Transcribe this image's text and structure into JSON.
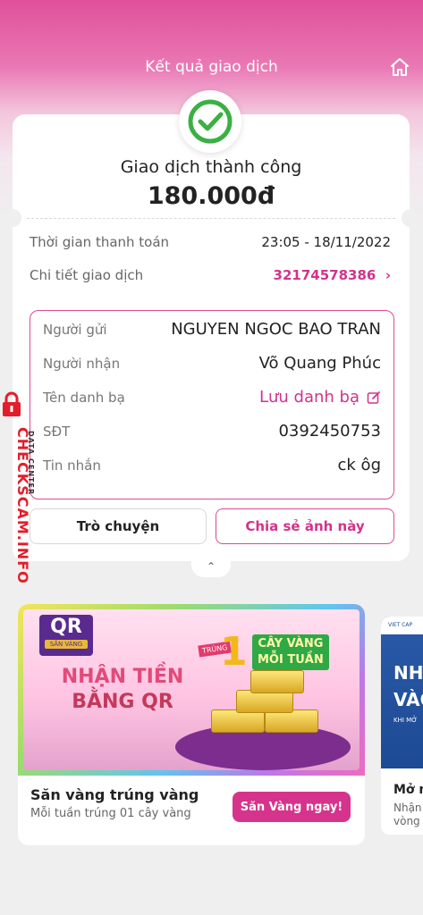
{
  "header": {
    "title": "Kết quả giao dịch",
    "home_icon": "home-icon"
  },
  "status": {
    "text": "Giao dịch thành công",
    "amount": "180.000đ"
  },
  "details": {
    "time_label": "Thời gian thanh toán",
    "time_value": "23:05 - 18/11/2022",
    "txn_label": "Chi tiết giao dịch",
    "txn_value": "32174578386"
  },
  "info": {
    "sender_label": "Người gửi",
    "sender_value": "NGUYEN NGOC BAO TRAN",
    "receiver_label": "Người nhận",
    "receiver_value": "Võ Quang Phúc",
    "contact_label": "Tên danh bạ",
    "contact_value": "Lưu danh bạ",
    "phone_label": "SĐT",
    "phone_value": "0392450753",
    "message_label": "Tin nhắn",
    "message_value": "ck ôg"
  },
  "actions": {
    "chat": "Trò chuyện",
    "share": "Chia sẻ ảnh này"
  },
  "promo": {
    "qr_logo": "QR",
    "qr_logo_sub": "SĂN VÀNG",
    "headline_1": "NHẬN TIỀN",
    "headline_2": "BẰNG QR",
    "prize_prefix": "TRÚNG",
    "prize_number": "1",
    "prize_text_1": "CÂY VÀNG",
    "prize_text_2": "MỖI TUẦN",
    "title": "Săn vàng trúng vàng",
    "subtitle": "Mỗi tuần trúng 01 cây vàng",
    "button": "Săn Vàng ngay!"
  },
  "promo2": {
    "brand": "VIET CAP",
    "big_1": "NHÂ",
    "big_2": "VÀO",
    "small": "KHI MỞ",
    "title": "Mở n",
    "sub_1": "Nhận",
    "sub_2": "vòng"
  },
  "watermark": {
    "text": "CHECKSCAM.INFO",
    "sub": "DATA CENTER"
  },
  "colors": {
    "accent": "#d2338c",
    "success": "#3cb043"
  }
}
